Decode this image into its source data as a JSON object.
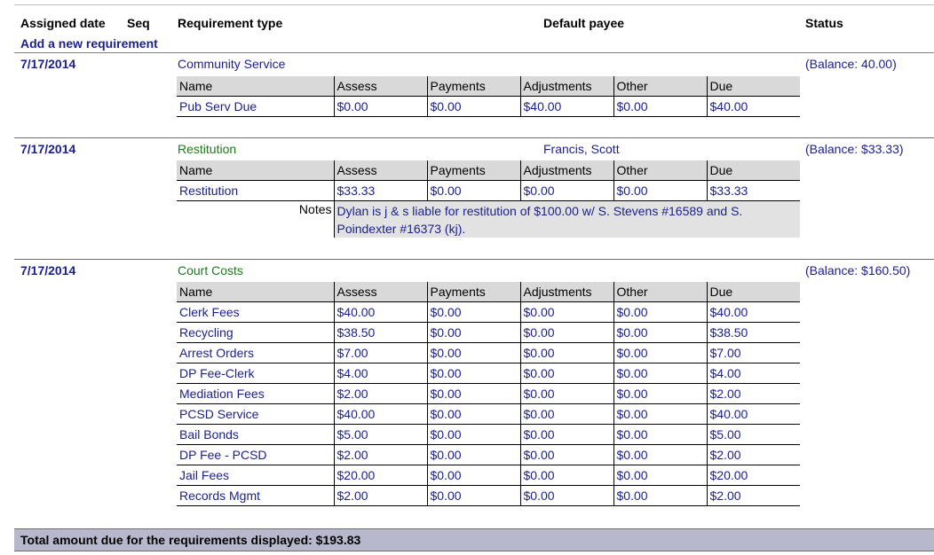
{
  "header": {
    "assigned_date": "Assigned date",
    "seq": "Seq",
    "requirement_type": "Requirement type",
    "default_payee": "Default payee",
    "status": "Status"
  },
  "add_link": "Add a new requirement",
  "columns": [
    "Name",
    "Assess",
    "Payments",
    "Adjustments",
    "Other",
    "Due"
  ],
  "groups": [
    {
      "date": "7/17/2014",
      "type": "Community Service",
      "payee": "",
      "balance": "(Balance: 40.00)",
      "rows": [
        [
          "Pub Serv Due",
          "$0.00",
          "$0.00",
          "$40.00",
          "$0.00",
          "$40.00"
        ]
      ]
    },
    {
      "date": "7/17/2014",
      "type": "Restitution",
      "payee": "Francis, Scott",
      "balance": "(Balance: $33.33)",
      "rows": [
        [
          "Restitution",
          "$33.33",
          "$0.00",
          "$0.00",
          "$0.00",
          "$33.33"
        ]
      ],
      "notes_label": "Notes",
      "notes": "Dylan is j & s liable for restitution of $100.00 w/ S. Stevens #16589 and S. Poindexter #16373 (kj)."
    },
    {
      "date": "7/17/2014",
      "type": "Court Costs",
      "payee": "",
      "balance": "(Balance: $160.50)",
      "rows": [
        [
          "Clerk Fees",
          "$40.00",
          "$0.00",
          "$0.00",
          "$0.00",
          "$40.00"
        ],
        [
          "Recycling",
          "$38.50",
          "$0.00",
          "$0.00",
          "$0.00",
          "$38.50"
        ],
        [
          "Arrest Orders",
          "$7.00",
          "$0.00",
          "$0.00",
          "$0.00",
          "$7.00"
        ],
        [
          "DP Fee-Clerk",
          "$4.00",
          "$0.00",
          "$0.00",
          "$0.00",
          "$4.00"
        ],
        [
          "Mediation Fees",
          "$2.00",
          "$0.00",
          "$0.00",
          "$0.00",
          "$2.00"
        ],
        [
          "PCSD Service",
          "$40.00",
          "$0.00",
          "$0.00",
          "$0.00",
          "$40.00"
        ],
        [
          "Bail Bonds",
          "$5.00",
          "$0.00",
          "$0.00",
          "$0.00",
          "$5.00"
        ],
        [
          "DP Fee - PCSD",
          "$2.00",
          "$0.00",
          "$0.00",
          "$0.00",
          "$2.00"
        ],
        [
          "Jail Fees",
          "$20.00",
          "$0.00",
          "$0.00",
          "$0.00",
          "$20.00"
        ],
        [
          "Records Mgmt",
          "$2.00",
          "$0.00",
          "$0.00",
          "$0.00",
          "$2.00"
        ]
      ]
    }
  ],
  "footer": "Total amount due for the requirements displayed: $193.83",
  "colors": {
    "link_blue": "#1a1f8c",
    "type_green": "#1b7a1b",
    "header_gray": "#d9d9d9",
    "footer_bg": "#b7b8cc"
  }
}
